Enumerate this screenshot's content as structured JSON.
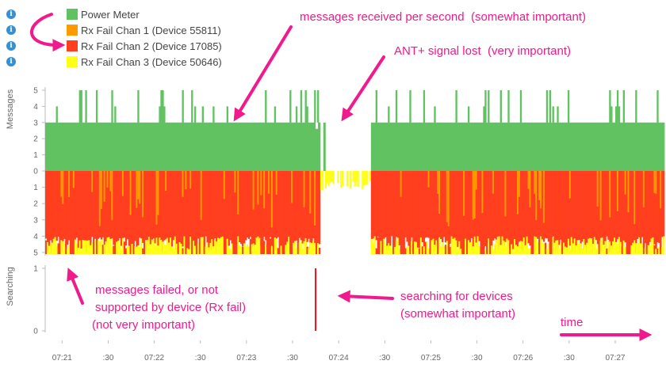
{
  "legend": {
    "items": [
      {
        "label": "Power Meter",
        "color": "#61c261",
        "info_icon": "info-icon"
      },
      {
        "label": "Rx Fail Chan 1 (Device 55811)",
        "color": "#ff9a00",
        "info_icon": "info-icon"
      },
      {
        "label": "Rx Fail Chan 2 (Device 17085)",
        "color": "#ff3f1f",
        "info_icon": "info-icon"
      },
      {
        "label": "Rx Fail Chan 3 (Device 50646)",
        "color": "#ffff1a",
        "info_icon": "info-icon"
      }
    ]
  },
  "annotations": {
    "messages_received_title": "messages received per second",
    "messages_received_note": "(somewhat important)",
    "signal_lost_title": "ANT+ signal lost",
    "signal_lost_note": "(very important)",
    "rx_fail_line1": "messages failed, or not",
    "rx_fail_line2": "supported by device (Rx fail)",
    "rx_fail_note": "(not very important)",
    "searching_title": "searching for devices",
    "searching_note": "(somewhat important)",
    "time_label": "time"
  },
  "colors": {
    "annotation": "#f01a8c",
    "searching_line": "#e8111d",
    "axis": "#bbbbbb",
    "tick_text": "#666666"
  },
  "chart_data": [
    {
      "type": "bar",
      "ylabel": "Messages",
      "ylim_top": [
        0,
        5
      ],
      "ylim_bottom": [
        0,
        5
      ],
      "yticks_top": [
        "5",
        "4",
        "3",
        "2",
        "1",
        "0"
      ],
      "yticks_bottom": [
        "1",
        "2",
        "3",
        "4",
        "5"
      ],
      "xticks": [
        "07:21",
        ":30",
        "07:22",
        ":30",
        "07:23",
        ":30",
        "07:24",
        ":30",
        "07:25",
        ":30",
        "07:26",
        ":30",
        "07:27"
      ],
      "series": [
        {
          "name": "Power Meter",
          "direction": "up",
          "baseline": 3,
          "spikes": [
            4,
            5
          ],
          "gap": [
            "07:23:48",
            "07:24:20"
          ]
        },
        {
          "name": "Rx Fail Chan 1 (Device 55811)",
          "direction": "down",
          "typical": 1
        },
        {
          "name": "Rx Fail Chan 2 (Device 17085)",
          "direction": "down",
          "baseline": 5,
          "gap": [
            "07:23:48",
            "07:24:20"
          ]
        },
        {
          "name": "Rx Fail Chan 3 (Device 50646)",
          "direction": "down",
          "typical": 5
        }
      ]
    },
    {
      "type": "line",
      "ylabel": "Searching",
      "ylim": [
        0,
        1
      ],
      "yticks": [
        "1",
        "0"
      ],
      "events": [
        {
          "time": "07:23:45",
          "value": 1
        }
      ]
    }
  ]
}
